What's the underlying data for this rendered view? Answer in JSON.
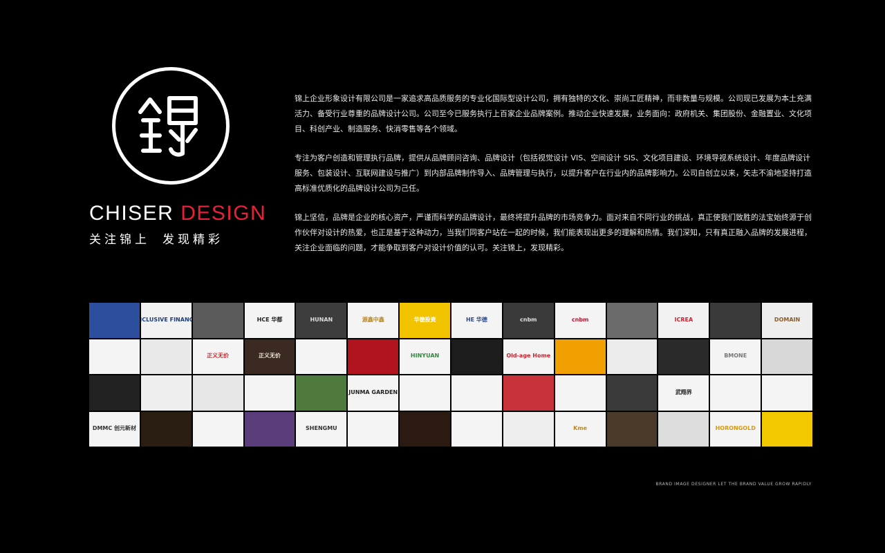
{
  "brand": {
    "word1": "CHISER",
    "word2": "DESIGN",
    "accent_color": "#e8213a"
  },
  "slogan": {
    "part1": "关注锦上",
    "part2": "发现精彩"
  },
  "logo": {
    "icon": "jin-character-seal-icon"
  },
  "intro": [
    "锦上企业形象设计有限公司是一家追求高品质服务的专业化国际型设计公司，拥有独特的文化、崇尚工匠精神，而非数量与规模。公司现已发展为本土充满活力、备受行业尊重的品牌设计公司。公司至今已服务执行上百家企业品牌案例。推动企业快速发展，业务面向：政府机关、集团股份、金融置业、文化项目、科创产业、制造服务、快消零售等各个领域。",
    "专注为客户创造和管理执行品牌，提供从品牌顾问咨询、品牌设计（包括视觉设计 VIS、空间设计 SIS、文化项目建设、环境导视系统设计、年度品牌设计服务、包装设计、互联网建设与推广）到内部品牌制作导入、品牌管理与执行，以提升客户在行业内的品牌影响力。公司自创立以来，矢志不渝地坚持打造高标准优质化的品牌设计公司为己任。",
    "锦上坚信，品牌是企业的核心资产，严谨而科学的品牌设计，最终将提升品牌的市场竞争力。面对来自不同行业的挑战，真正使我们致胜的法宝始终源于创作伙伴对设计的热爱，也正是基于这种动力，当我们同客户站在一起的时候，我们能表现出更多的理解和热情。我们深知，只有真正融入品牌的发展进程，关注企业面临的问题，才能争取到客户对设计价值的认可。关注锦上，发现精彩。"
  ],
  "portfolio": [
    {
      "label": "",
      "bg": "#2b4f9c",
      "fg": "#ffffff"
    },
    {
      "label": "INCLUSIVE FINANCE",
      "bg": "#f2f2f2",
      "fg": "#1d3d7a"
    },
    {
      "label": "",
      "bg": "#5a5a5a",
      "fg": "#ffffff"
    },
    {
      "label": "HCE 华都",
      "bg": "#f4f4f4",
      "fg": "#222222"
    },
    {
      "label": "HUNAN",
      "bg": "#3d3d3d",
      "fg": "#dddddd"
    },
    {
      "label": "源鑫中鑫",
      "bg": "#f4f4f4",
      "fg": "#b8892a"
    },
    {
      "label": "华德投资",
      "bg": "#f2c400",
      "fg": "#ffffff"
    },
    {
      "label": "HE 华德",
      "bg": "#f4f4f4",
      "fg": "#2a4c8f"
    },
    {
      "label": "cnbm",
      "bg": "#3a3a3a",
      "fg": "#e0e0e0"
    },
    {
      "label": "cnbm",
      "bg": "#f4f4f4",
      "fg": "#c4122e"
    },
    {
      "label": "",
      "bg": "#6b6b6b",
      "fg": "#ffffff"
    },
    {
      "label": "ICREA",
      "bg": "#f2f2f2",
      "fg": "#d4202c"
    },
    {
      "label": "",
      "bg": "#3a3a3a",
      "fg": "#eeeeee"
    },
    {
      "label": "DOMAIN",
      "bg": "#eeeeee",
      "fg": "#8a5a2a"
    },
    {
      "label": "",
      "bg": "#f4f4f4",
      "fg": "#e08a1a"
    },
    {
      "label": "",
      "bg": "#e9e9e9",
      "fg": "#999999"
    },
    {
      "label": "正义无价",
      "bg": "#f4f4f4",
      "fg": "#d4202c"
    },
    {
      "label": "正义无价",
      "bg": "#3a2a22",
      "fg": "#f0e6d0"
    },
    {
      "label": "",
      "bg": "#f4f4f4",
      "fg": "#b82020"
    },
    {
      "label": "",
      "bg": "#b1141f",
      "fg": "#ffffff"
    },
    {
      "label": "HINYUAN",
      "bg": "#f4f4f4",
      "fg": "#2e8a3a"
    },
    {
      "label": "",
      "bg": "#1d1d1d",
      "fg": "#4caf50"
    },
    {
      "label": "Old-age Home",
      "bg": "#f4f4f4",
      "fg": "#d4202c"
    },
    {
      "label": "",
      "bg": "#f0a000",
      "fg": "#ffffff"
    },
    {
      "label": "",
      "bg": "#ececec",
      "fg": "#333333"
    },
    {
      "label": "",
      "bg": "#2a2a2a",
      "fg": "#ffffff"
    },
    {
      "label": "BMONE",
      "bg": "#f4f4f4",
      "fg": "#777777"
    },
    {
      "label": "",
      "bg": "#d8d8d8",
      "fg": "#ffffff"
    },
    {
      "label": "",
      "bg": "#222222",
      "fg": "#ffffff"
    },
    {
      "label": "",
      "bg": "#eeeeee",
      "fg": "#9a6a3a"
    },
    {
      "label": "",
      "bg": "#e6e6e6",
      "fg": "#555555"
    },
    {
      "label": "",
      "bg": "#f4f4f4",
      "fg": "#222222"
    },
    {
      "label": "",
      "bg": "#4e7a3e",
      "fg": "#ffffff"
    },
    {
      "label": "JUNMA GARDEN",
      "bg": "#f4f4f4",
      "fg": "#222222"
    },
    {
      "label": "",
      "bg": "#f4f4f4",
      "fg": "#333333"
    },
    {
      "label": "",
      "bg": "#f4f4f4",
      "fg": "#222222"
    },
    {
      "label": "",
      "bg": "#c8323a",
      "fg": "#ffffff"
    },
    {
      "label": "",
      "bg": "#f4f4f4",
      "fg": "#333333"
    },
    {
      "label": "",
      "bg": "#3a3a3a",
      "fg": "#f0e6d0"
    },
    {
      "label": "武翔界",
      "bg": "#f4f4f4",
      "fg": "#222222"
    },
    {
      "label": "",
      "bg": "#f4f4f4",
      "fg": "#555555"
    },
    {
      "label": "",
      "bg": "#f4f4f4",
      "fg": "#222222"
    },
    {
      "label": "DMMC 创元新材",
      "bg": "#f4f4f4",
      "fg": "#333333"
    },
    {
      "label": "",
      "bg": "#2a1e12",
      "fg": "#f0c060"
    },
    {
      "label": "",
      "bg": "#f4f4f4",
      "fg": "#d83b8b"
    },
    {
      "label": "",
      "bg": "#5a3d7a",
      "fg": "#ffffff"
    },
    {
      "label": "SHENGMU",
      "bg": "#f4f4f4",
      "fg": "#333333"
    },
    {
      "label": "",
      "bg": "#f4f4f4",
      "fg": "#2e6fb8"
    },
    {
      "label": "",
      "bg": "#2a1a12",
      "fg": "#ffffff"
    },
    {
      "label": "",
      "bg": "#f4f4f4",
      "fg": "#c4122e"
    },
    {
      "label": "",
      "bg": "#eeeeee",
      "fg": "#cccccc"
    },
    {
      "label": "Kme",
      "bg": "#f4f4f4",
      "fg": "#b8892a"
    },
    {
      "label": "",
      "bg": "#4a3a2a",
      "fg": "#ffffff"
    },
    {
      "label": "",
      "bg": "#dddddd",
      "fg": "#555555"
    },
    {
      "label": "HORONGOLD",
      "bg": "#f4f4f4",
      "fg": "#d49a10"
    },
    {
      "label": "",
      "bg": "#f2c800",
      "fg": "#ffffff"
    },
    {
      "label": "",
      "bg": "#f4f4f4",
      "fg": "#2e8a3a"
    },
    {
      "label": "",
      "bg": "#eeeeee",
      "fg": "#2e8a3a"
    }
  ],
  "footer": "BRAND IMAGE DESIGNER   LET THE BRAND VALUE GROW RAPIDLY"
}
